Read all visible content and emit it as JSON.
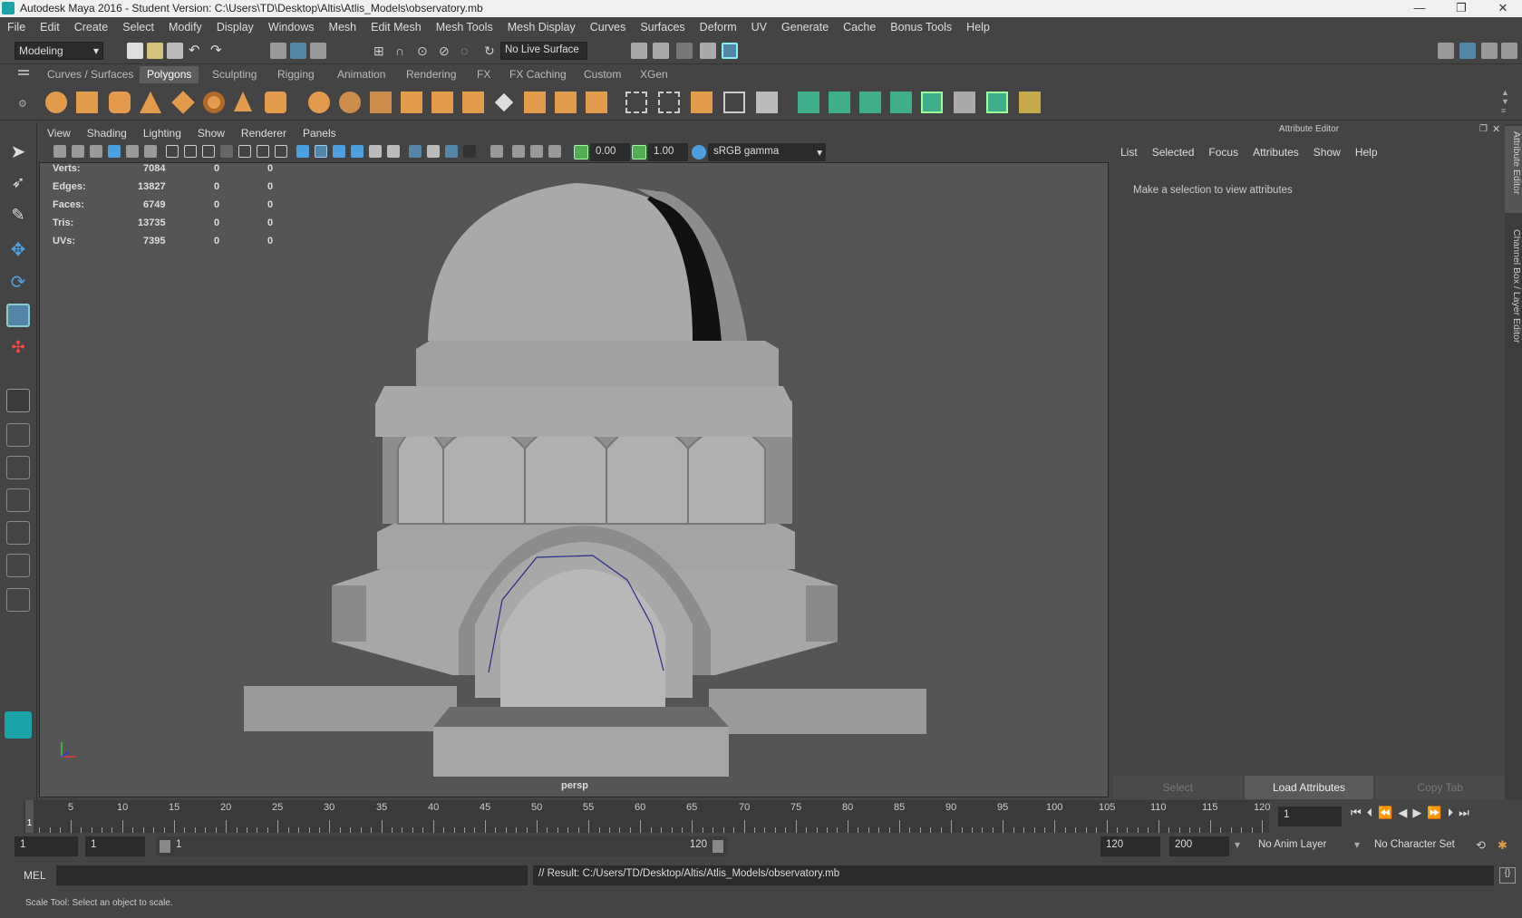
{
  "title": "Autodesk Maya 2016 - Student Version: C:\\Users\\TD\\Desktop\\Altis\\Atlis_Models\\observatory.mb",
  "menus": [
    "File",
    "Edit",
    "Create",
    "Select",
    "Modify",
    "Display",
    "Windows",
    "Mesh",
    "Edit Mesh",
    "Mesh Tools",
    "Mesh Display",
    "Curves",
    "Surfaces",
    "Deform",
    "UV",
    "Generate",
    "Cache",
    "Bonus Tools",
    "Help"
  ],
  "workspace": "Modeling",
  "live_surface": "No Live Surface",
  "shelf_tabs": [
    "Curves / Surfaces",
    "Polygons",
    "Sculpting",
    "Rigging",
    "Animation",
    "Rendering",
    "FX",
    "FX Caching",
    "Custom",
    "XGen"
  ],
  "selected_shelf_tab": "Polygons",
  "viewport_menu": [
    "View",
    "Shading",
    "Lighting",
    "Show",
    "Renderer",
    "Panels"
  ],
  "viewport_fields": {
    "exposure": "0.00",
    "gamma": "1.00",
    "colorspace": "sRGB gamma"
  },
  "hud": [
    {
      "label": "Verts:",
      "v1": "7084",
      "v2": "0",
      "v3": "0"
    },
    {
      "label": "Edges:",
      "v1": "13827",
      "v2": "0",
      "v3": "0"
    },
    {
      "label": "Faces:",
      "v1": "6749",
      "v2": "0",
      "v3": "0"
    },
    {
      "label": "Tris:",
      "v1": "13735",
      "v2": "0",
      "v3": "0"
    },
    {
      "label": "UVs:",
      "v1": "7395",
      "v2": "0",
      "v3": "0"
    }
  ],
  "camera": "persp",
  "attribute_editor": {
    "title": "Attribute Editor",
    "menu": [
      "List",
      "Selected",
      "Focus",
      "Attributes",
      "Show",
      "Help"
    ],
    "message": "Make a selection to view attributes",
    "buttons": [
      "Select",
      "Load Attributes",
      "Copy Tab"
    ]
  },
  "side_tabs": [
    "Attribute Editor",
    "Channel Box / Layer Editor"
  ],
  "timeline": {
    "ticks": [
      "5",
      "10",
      "15",
      "20",
      "25",
      "30",
      "35",
      "40",
      "45",
      "50",
      "55",
      "60",
      "65",
      "70",
      "75",
      "80",
      "85",
      "90",
      "95",
      "100",
      "105",
      "110",
      "115",
      "120"
    ],
    "current_marker": "1",
    "current_frame": "1"
  },
  "range": {
    "start": "1",
    "playback_start": "1",
    "slider_start": "1",
    "slider_end": "120",
    "playback_end": "120",
    "end": "200",
    "anim_layer": "No Anim Layer",
    "character_set": "No Character Set"
  },
  "command_line": {
    "mode": "MEL",
    "result": "// Result: C:/Users/TD/Desktop/Altis/Atlis_Models/observatory.mb"
  },
  "help_line": "Scale Tool: Select an object to scale.",
  "colors": {
    "accent": "#5285a6",
    "shelf_orange": "#e39a4a",
    "shelf_green": "#3fae8a"
  }
}
